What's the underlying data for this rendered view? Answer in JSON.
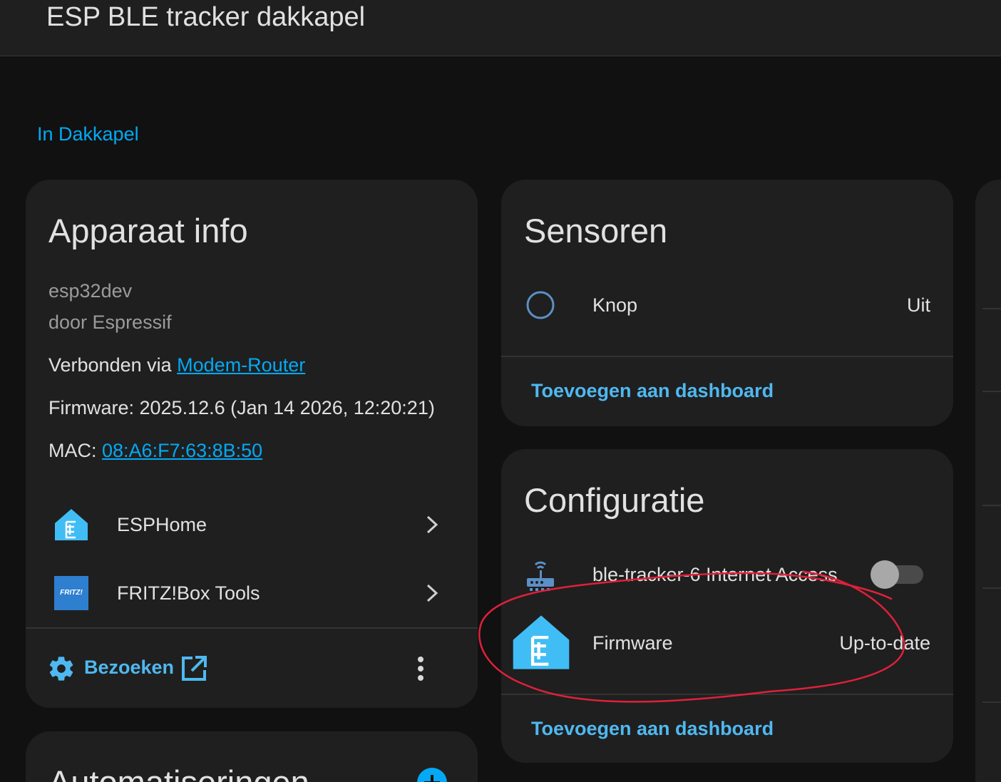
{
  "topbar": {
    "title": "ESP BLE tracker dakkapel"
  },
  "area": {
    "link": "In Dakkapel"
  },
  "device_info": {
    "title": "Apparaat info",
    "model": "esp32dev",
    "manufacturer": "door Espressif",
    "connected_prefix": "Verbonden via",
    "connected_link": "Modem-Router",
    "firmware": "Firmware: 2025.12.6 (Jan 14 2026, 12:20:21)",
    "mac_prefix": "MAC:",
    "mac_link": "08:A6:F7:63:8B:50",
    "integrations": [
      {
        "label": "ESPHome",
        "icon": "esphome-icon"
      },
      {
        "label": "FRITZ!Box Tools",
        "icon": "fritzbox-icon",
        "icon_text": "FRITZ!"
      }
    ],
    "visit_label": "Bezoeken"
  },
  "sensors": {
    "title": "Sensoren",
    "rows": [
      {
        "name": "Knop",
        "state": "Uit",
        "icon": "circle-outline-icon"
      }
    ],
    "add_label": "Toevoegen aan dashboard"
  },
  "config": {
    "title": "Configuratie",
    "rows": [
      {
        "name": "ble-tracker-6 Internet Access",
        "icon": "router-wireless-icon",
        "toggle": false
      },
      {
        "name": "Firmware",
        "state": "Up-to-date",
        "icon": "esphome-icon"
      }
    ],
    "add_label": "Toevoegen aan dashboard"
  },
  "automations": {
    "title": "Automatiseringen"
  },
  "colors": {
    "accent": "#03a9f4",
    "card": "#1f1f1f",
    "background": "#111111",
    "annotation": "#e0203a"
  }
}
